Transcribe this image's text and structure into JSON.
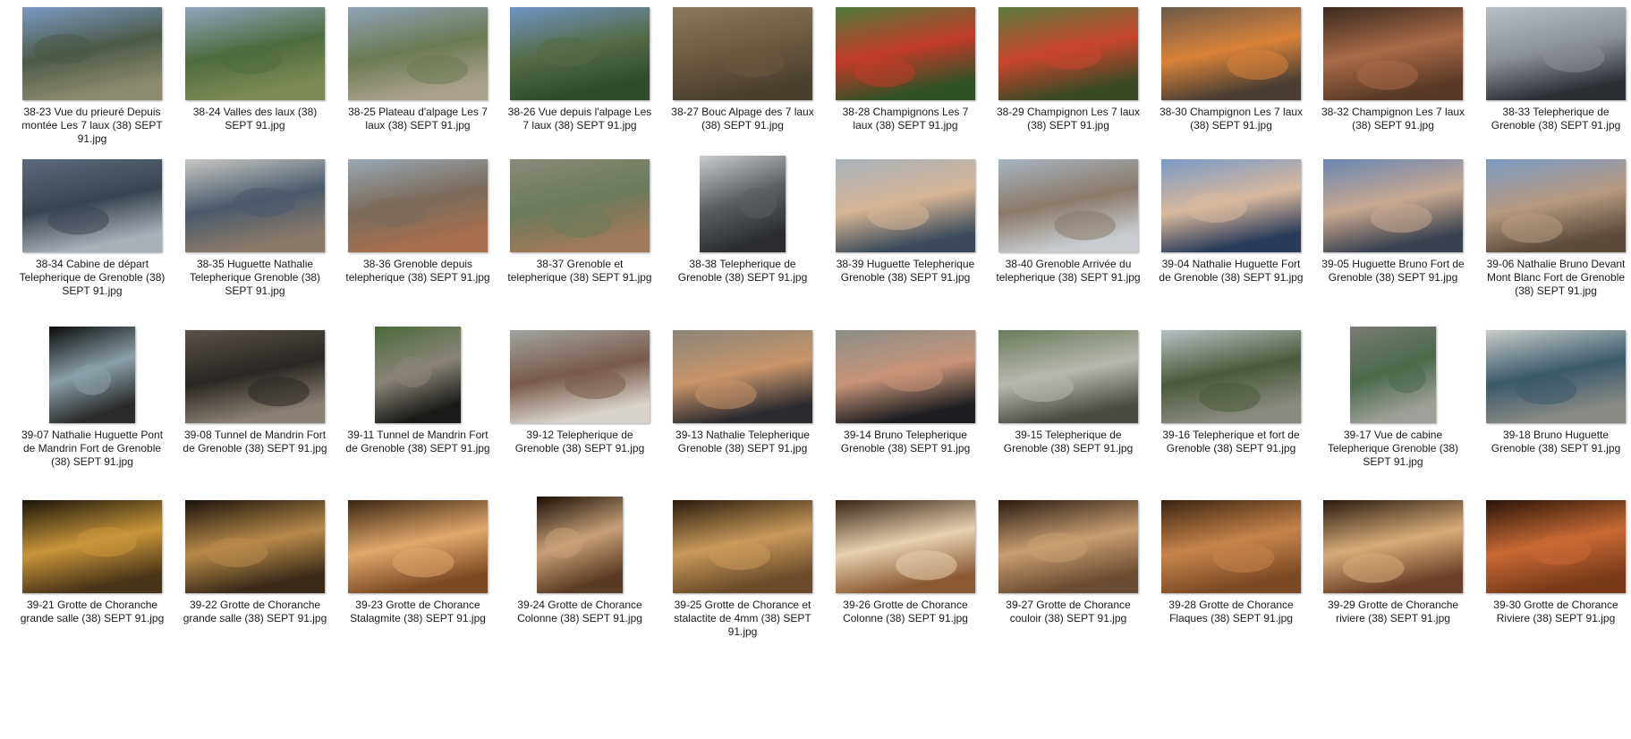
{
  "items": [
    {
      "caption": "38-23 Vue du prieuré Depuis montée Les 7 laux (38) SEPT 91.jpg",
      "orient": "landscape",
      "colors": [
        "#7a9ac4",
        "#4d5a48",
        "#8c8a6c"
      ]
    },
    {
      "caption": "38-24 Valles des laux (38) SEPT 91.jpg",
      "orient": "landscape",
      "colors": [
        "#8fa6bf",
        "#4e6b3e",
        "#7d8a55"
      ]
    },
    {
      "caption": "38-25 Plateau d'alpage Les 7 laux (38) SEPT 91.jpg",
      "orient": "landscape",
      "colors": [
        "#8fa3b8",
        "#6b7a52",
        "#a9a18a"
      ]
    },
    {
      "caption": "38-26 Vue depuis l'alpage Les 7 laux (38) SEPT 91.jpg",
      "orient": "landscape",
      "colors": [
        "#6f93c4",
        "#546b45",
        "#2f4a2c"
      ]
    },
    {
      "caption": "38-27 Bouc Alpage des 7 laux (38) SEPT 91.jpg",
      "orient": "landscape",
      "colors": [
        "#8a7a5c",
        "#6b5a3e",
        "#4a4030"
      ]
    },
    {
      "caption": "38-28 Champignons Les 7 laux (38) SEPT 91.jpg",
      "orient": "landscape",
      "colors": [
        "#4f7a3a",
        "#c23a2a",
        "#2f5226"
      ]
    },
    {
      "caption": "38-29 Champignon Les 7 laux (38) SEPT 91.jpg",
      "orient": "landscape",
      "colors": [
        "#5a7a3e",
        "#c9452e",
        "#3a4a24"
      ]
    },
    {
      "caption": "38-30 Champignon Les 7 laux (38) SEPT 91.jpg",
      "orient": "landscape",
      "colors": [
        "#6b5a48",
        "#d9823a",
        "#4a3e32"
      ]
    },
    {
      "caption": "38-32 Champignon Les 7 laux (38) SEPT 91.jpg",
      "orient": "landscape",
      "colors": [
        "#3a2a1e",
        "#a86a48",
        "#5a3a26"
      ]
    },
    {
      "caption": "38-33 Telepherique de Grenoble (38) SEPT 91.jpg",
      "orient": "landscape",
      "colors": [
        "#b7c0c8",
        "#8a9096",
        "#2c3035"
      ]
    },
    {
      "caption": "38-34 Cabine de départ Telepherique de Grenoble (38) SEPT 91.jpg",
      "orient": "landscape",
      "colors": [
        "#5a6a7a",
        "#3a4450",
        "#a8b0b8"
      ]
    },
    {
      "caption": "38-35 Huguette Nathalie Telepherique Grenoble (38) SEPT 91.jpg",
      "orient": "landscape",
      "colors": [
        "#c8c8c4",
        "#4a5a6a",
        "#8a7a6a"
      ]
    },
    {
      "caption": "38-36 Grenoble depuis telepherique (38) SEPT 91.jpg",
      "orient": "landscape",
      "colors": [
        "#9aa8b4",
        "#7a6a5a",
        "#a8704e"
      ]
    },
    {
      "caption": "38-37 Grenoble et telepherique (38) SEPT 91.jpg",
      "orient": "landscape",
      "colors": [
        "#8a8a7a",
        "#6a7a5a",
        "#a07a5a"
      ]
    },
    {
      "caption": "38-38 Telepherique de Grenoble (38) SEPT 91.jpg",
      "orient": "portrait",
      "colors": [
        "#c8ccd0",
        "#5a5e62",
        "#2a2c30"
      ]
    },
    {
      "caption": "38-39 Huguette Telepherique Grenoble (38) SEPT 91.jpg",
      "orient": "landscape",
      "colors": [
        "#a8b4be",
        "#d6b494",
        "#3a4a5a"
      ]
    },
    {
      "caption": "38-40 Grenoble Arrivée du telepherique (38) SEPT 91.jpg",
      "orient": "landscape",
      "colors": [
        "#a8b4c0",
        "#8a7a6a",
        "#c8ccd0"
      ]
    },
    {
      "caption": "39-04 Nathalie Huguette Fort de Grenoble (38) SEPT 91.jpg",
      "orient": "landscape",
      "colors": [
        "#7a9ac8",
        "#d8b89c",
        "#2a3a5a"
      ]
    },
    {
      "caption": "39-05 Huguette Bruno Fort de Grenoble (38) SEPT 91.jpg",
      "orient": "landscape",
      "colors": [
        "#6a86b4",
        "#c8a890",
        "#3a4250"
      ]
    },
    {
      "caption": "39-06 Nathalie Bruno Devant Mont Blanc Fort de Grenoble (38) SEPT 91.jpg",
      "orient": "landscape",
      "colors": [
        "#7a9ac4",
        "#b89a80",
        "#5a4a3a"
      ]
    },
    {
      "caption": "39-07 Nathalie Huguette Pont de Mandrin Fort de Grenoble (38) SEPT 91.jpg",
      "orient": "portrait",
      "colors": [
        "#0a0a0a",
        "#8aa0a8",
        "#2a2a2a"
      ]
    },
    {
      "caption": "39-08 Tunnel de Mandrin Fort de Grenoble (38) SEPT 91.jpg",
      "orient": "landscape",
      "colors": [
        "#5a524a",
        "#2a2622",
        "#8a8074"
      ]
    },
    {
      "caption": "39-11 Tunnel de Mandrin Fort de Grenoble (38) SEPT 91.jpg",
      "orient": "portrait",
      "colors": [
        "#4a6a3a",
        "#8a8478",
        "#1a1a18"
      ]
    },
    {
      "caption": "39-12 Telepherique de Grenoble (38) SEPT 91.jpg",
      "orient": "landscape",
      "colors": [
        "#a0a4a0",
        "#7a5a4a",
        "#d8d4cc"
      ]
    },
    {
      "caption": "39-13 Nathalie Telepherique Grenoble (38) SEPT 91.jpg",
      "orient": "landscape",
      "colors": [
        "#8a8678",
        "#c8946a",
        "#2a2a30"
      ]
    },
    {
      "caption": "39-14 Bruno Telepherique Grenoble (38) SEPT 91.jpg",
      "orient": "landscape",
      "colors": [
        "#8a8e88",
        "#c89478",
        "#1e1e22"
      ]
    },
    {
      "caption": "39-15 Telepherique de Grenoble (38) SEPT 91.jpg",
      "orient": "landscape",
      "colors": [
        "#6a7a5a",
        "#b8b8b0",
        "#4a4a42"
      ]
    },
    {
      "caption": "39-16 Telepherique et fort de Grenoble (38) SEPT 91.jpg",
      "orient": "landscape",
      "colors": [
        "#b8c0c4",
        "#4a5a3a",
        "#8a8a80"
      ]
    },
    {
      "caption": "39-17 Vue de cabine Telepherique Grenoble (38) SEPT 91.jpg",
      "orient": "portrait",
      "colors": [
        "#7a7a74",
        "#4a6a4a",
        "#a0a09a"
      ]
    },
    {
      "caption": "39-18 Bruno Huguette Grenoble (38) SEPT 91.jpg",
      "orient": "landscape",
      "colors": [
        "#c8ccc8",
        "#3a5a6a",
        "#8a8a84"
      ]
    },
    {
      "caption": "39-21 Grotte de Choranche grande salle (38) SEPT 91.jpg",
      "orient": "landscape",
      "colors": [
        "#1a140a",
        "#c8963a",
        "#4a3418"
      ]
    },
    {
      "caption": "39-22 Grotte de Choranche grande salle (38) SEPT 91.jpg",
      "orient": "landscape",
      "colors": [
        "#1a120a",
        "#b88a4a",
        "#3a2a18"
      ]
    },
    {
      "caption": "39-23 Grotte de Chorance Stalagmite (38) SEPT 91.jpg",
      "orient": "landscape",
      "colors": [
        "#3a2412",
        "#e0a86a",
        "#7a4a24"
      ]
    },
    {
      "caption": "39-24 Grotte de Chorance Colonne (38) SEPT 91.jpg",
      "orient": "portrait",
      "colors": [
        "#1a0e06",
        "#c8a078",
        "#5a3a22"
      ]
    },
    {
      "caption": "39-25 Grotte de Chorance et stalactite de 4mm (38) SEPT 91.jpg",
      "orient": "landscape",
      "colors": [
        "#2a1a0c",
        "#c89a5a",
        "#6a4a2a"
      ]
    },
    {
      "caption": "39-26 Grotte de Chorance Colonne (38) SEPT 91.jpg",
      "orient": "landscape",
      "colors": [
        "#3a2414",
        "#e8d0b0",
        "#8a5a34"
      ]
    },
    {
      "caption": "39-27 Grotte de Chorance couloir (38) SEPT 91.jpg",
      "orient": "landscape",
      "colors": [
        "#2a1a10",
        "#c89e72",
        "#6a4a30"
      ]
    },
    {
      "caption": "39-28 Grotte de Chorance Flaques (38) SEPT 91.jpg",
      "orient": "landscape",
      "colors": [
        "#3a2412",
        "#c8844a",
        "#7a4a26"
      ]
    },
    {
      "caption": "39-29 Grotte de Choranche riviere (38) SEPT 91.jpg",
      "orient": "landscape",
      "colors": [
        "#2a1a0e",
        "#d8ac7a",
        "#6a4028"
      ]
    },
    {
      "caption": "39-30 Grotte de Chorance Riviere (38) SEPT 91.jpg",
      "orient": "landscape",
      "colors": [
        "#2a1408",
        "#c86a34",
        "#7a3a1a"
      ]
    }
  ]
}
